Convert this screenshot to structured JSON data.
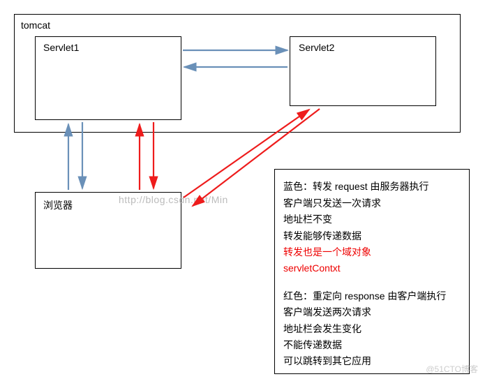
{
  "tomcat": {
    "label": "tomcat"
  },
  "servlet1": {
    "label": "Servlet1"
  },
  "servlet2": {
    "label": "Servlet2"
  },
  "browser": {
    "label": "浏览器"
  },
  "watermark": "http://blog.csdn.net/Min",
  "credit": "@51CTO博客",
  "legend": {
    "blue_title": "蓝色：转发 request  由服务器执行",
    "blue_line1": "客户端只发送一次请求",
    "blue_line2": "地址栏不变",
    "blue_line3": "转发能够传递数据",
    "blue_red1": "转发也是一个域对象",
    "blue_red2": "servletContxt",
    "red_title": "红色：重定向 response  由客户端执行",
    "red_line1": "客户端发送两次请求",
    "red_line2": "地址栏会发生变化",
    "red_line3": "不能传递数据",
    "red_line4": "可以跳转到其它应用"
  },
  "colors": {
    "blue": "#6a90b8",
    "red": "#ee1c1c"
  }
}
